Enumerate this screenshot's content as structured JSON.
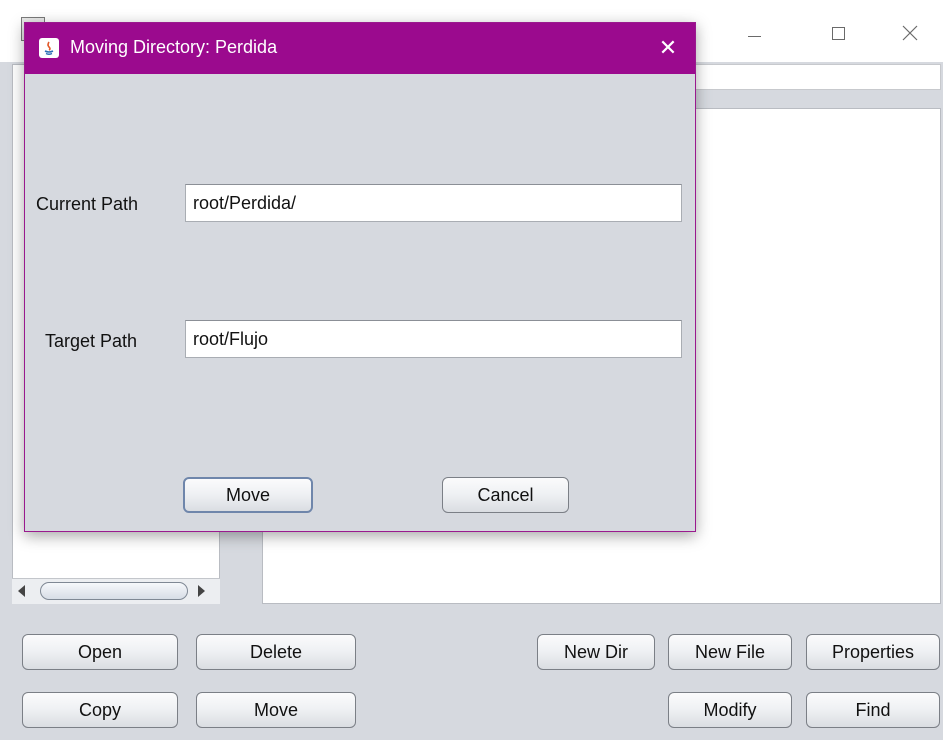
{
  "main_window": {
    "buttons": {
      "open": "Open",
      "delete": "Delete",
      "new_dir": "New Dir",
      "new_file": "New File",
      "properties": "Properties",
      "copy": "Copy",
      "move": "Move",
      "modify": "Modify",
      "find": "Find"
    },
    "window_controls": {
      "minimize": "minimize-icon",
      "maximize": "maximize-icon",
      "close": "close-icon"
    }
  },
  "dialog": {
    "title": "Moving Directory: Perdida",
    "close_glyph": "✕",
    "current_path_label": "Current Path",
    "current_path_value": "root/Perdida/",
    "target_path_label": "Target Path",
    "target_path_value": "root/Flujo",
    "move_label": "Move",
    "cancel_label": "Cancel",
    "title_bar_color": "#9b0a8e"
  }
}
